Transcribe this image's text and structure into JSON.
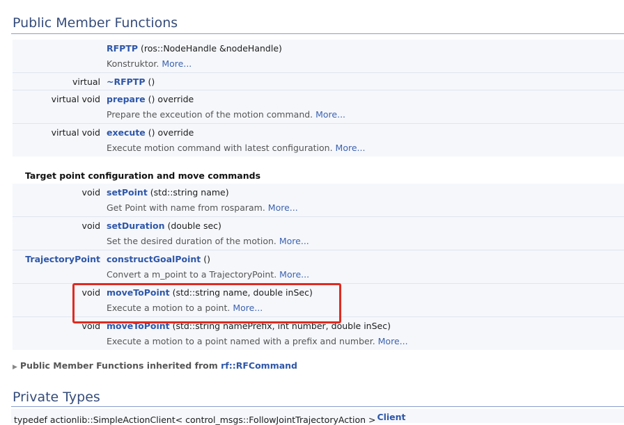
{
  "public_section": {
    "title": "Public Member Functions"
  },
  "members": [
    {
      "type": "",
      "name": "RFPTP",
      "signature": " (ros::NodeHandle &nodeHandle)",
      "description": "Konstruktor. ",
      "more": "More..."
    },
    {
      "type": "virtual",
      "name": "~RFPTP",
      "signature": " ()",
      "description": "",
      "more": ""
    },
    {
      "type": "virtual void",
      "name": "prepare",
      "signature": " () override",
      "description": "Prepare the exceution of the motion command. ",
      "more": "More..."
    },
    {
      "type": "virtual void",
      "name": "execute",
      "signature": " () override",
      "description": "Execute motion command with latest configuration. ",
      "more": "More..."
    }
  ],
  "group": {
    "title": "Target point configuration and move commands"
  },
  "group_members": [
    {
      "type": "void",
      "name": "setPoint",
      "signature": " (std::string name)",
      "description": "Get Point with name from rosparam. ",
      "more": "More..."
    },
    {
      "type": "void",
      "name": "setDuration",
      "signature": " (double sec)",
      "description": "Set the desired duration of the motion. ",
      "more": "More..."
    },
    {
      "type": "TrajectoryPoint",
      "name": "constructGoalPoint",
      "signature": " ()",
      "description": "Convert a m_point to a TrajectoryPoint. ",
      "more": "More..."
    },
    {
      "type": "void",
      "name": "moveToPoint",
      "signature": " (std::string name, double inSec)",
      "description": "Execute a motion to a point. ",
      "more": "More..."
    },
    {
      "type": "void",
      "name": "moveToPoint",
      "signature": " (std::string namePrefix, int number, double inSec)",
      "description": "Execute a motion to a point named with a prefix and number. ",
      "more": "More..."
    }
  ],
  "inherited": {
    "prefix": "Public Member Functions inherited from ",
    "link": "rf::RFCommand"
  },
  "private_section": {
    "title": "Private Types"
  },
  "typedef": {
    "text": "typedef actionlib::SimpleActionClient< control_msgs::FollowJointTrajectoryAction > ",
    "name": "Client"
  },
  "colors": {
    "heading": "#354c7b",
    "link": "#2f57a8",
    "highlight": "#e02a20",
    "row_bg": "#f5f7fb"
  }
}
